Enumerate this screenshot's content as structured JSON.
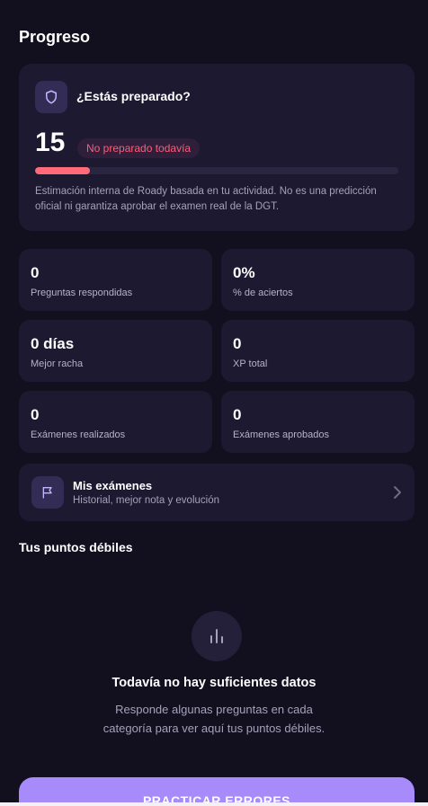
{
  "page": {
    "title": "Progreso"
  },
  "readiness": {
    "title": "¿Estás preparado?",
    "score": "15",
    "status": "No preparado todavía",
    "progress_fraction": 0.15,
    "disclaimer": "Estimación interna de Roady basada en tu actividad. No es una predicción oficial ni garantiza aprobar el examen real de la DGT.",
    "icon": "shield-icon"
  },
  "stats": [
    {
      "value": "0",
      "label": "Preguntas respondidas"
    },
    {
      "value": "0%",
      "label": "% de aciertos"
    },
    {
      "value": "0 días",
      "label": "Mejor racha"
    },
    {
      "value": "0",
      "label": "XP total"
    },
    {
      "value": "0",
      "label": "Exámenes realizados"
    },
    {
      "value": "0",
      "label": "Exámenes aprobados"
    }
  ],
  "exams": {
    "title": "Mis exámenes",
    "subtitle": "Historial, mejor nota y evolución",
    "icon": "flag-icon"
  },
  "weak_points": {
    "title": "Tus puntos débiles",
    "empty_title": "Todavía no hay suficientes datos",
    "empty_desc": "Responde algunas preguntas en cada categoría para ver aquí tus puntos débiles.",
    "icon": "bar-chart-icon"
  },
  "actions": {
    "practice_label": "PRACTICAR ERRORES"
  },
  "colors": {
    "background": "#120f1f",
    "card": "#1c1930",
    "accent": "#a78bfa",
    "danger": "#ff6b78"
  }
}
